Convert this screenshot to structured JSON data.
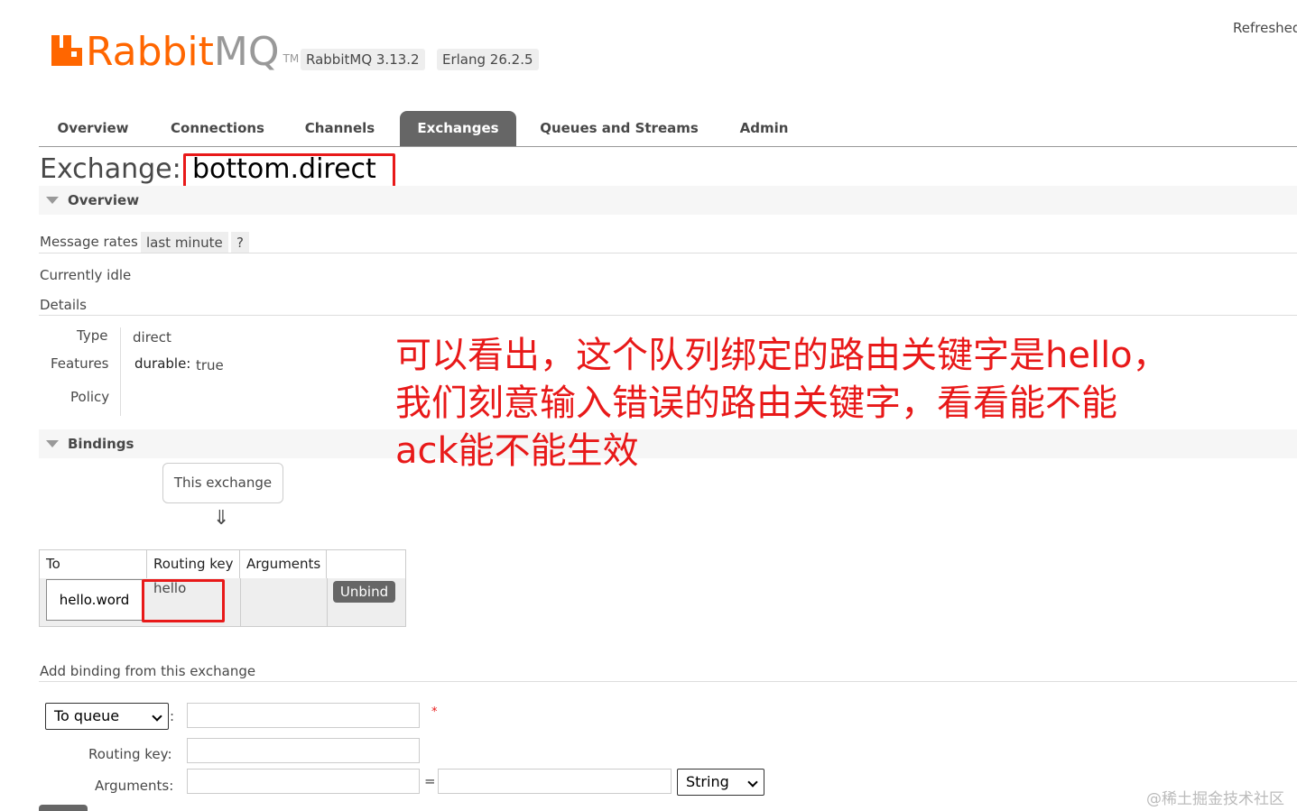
{
  "app": {
    "logo_rabbit": "Rabbit",
    "logo_mq": "MQ",
    "logo_tm": "TM",
    "version": "RabbitMQ 3.13.2",
    "erlang": "Erlang 26.2.5",
    "refreshed": "Refreshed"
  },
  "tabs": [
    "Overview",
    "Connections",
    "Channels",
    "Exchanges",
    "Queues and Streams",
    "Admin"
  ],
  "active_tab": "Exchanges",
  "page": {
    "title_prefix": "Exchange:",
    "exchange_name": "bottom.direct"
  },
  "overview": {
    "heading": "Overview",
    "message_rates_label": "Message rates",
    "rate_range": "last minute",
    "help": "?",
    "status": "Currently idle",
    "details_label": "Details",
    "type_label": "Type",
    "type_value": "direct",
    "features_label": "Features",
    "features_key": "durable:",
    "features_value": "true",
    "policy_label": "Policy"
  },
  "annotation": {
    "line1": "可以看出，这个队列绑定的路由关键字是hello，",
    "line2": "我们刻意输入错误的路由关键字，看看能不能",
    "line3": "ack能不能生效"
  },
  "bindings": {
    "heading": "Bindings",
    "this_exchange": "This exchange",
    "arrow": "⇓",
    "columns": [
      "To",
      "Routing key",
      "Arguments",
      ""
    ],
    "rows": [
      {
        "to": "hello.word",
        "routing_key": "hello",
        "arguments": "",
        "action": "Unbind"
      }
    ]
  },
  "add_binding": {
    "heading": "Add binding from this exchange",
    "destination_type": "To queue",
    "colon": ":",
    "required_mark": "*",
    "routing_key_label": "Routing key:",
    "arguments_label": "Arguments:",
    "equals": "=",
    "arg_type": "String"
  },
  "watermark": "@稀土掘金技术社区",
  "colors": {
    "brand_orange": "#ff6600",
    "annotation_red": "#e81919",
    "tab_active_bg": "#666666"
  }
}
